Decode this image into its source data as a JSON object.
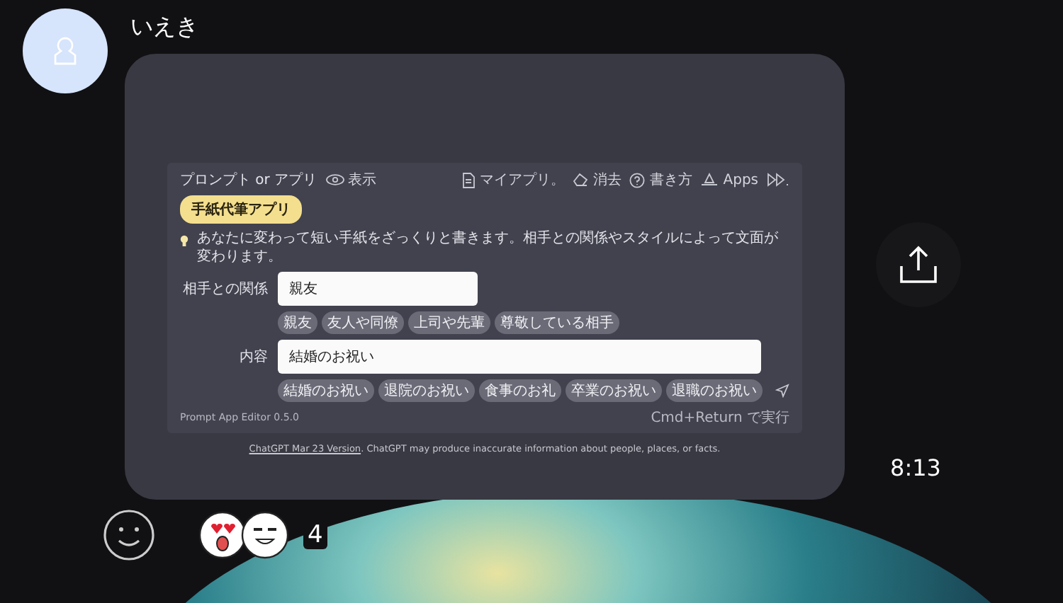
{
  "sender": {
    "name": "いえき"
  },
  "screenshot": {
    "toolbar": {
      "title": "プロンプト or アプリ",
      "view": "表示",
      "actions": [
        {
          "kind": "document",
          "label": "マイアプリ。"
        },
        {
          "kind": "eraser",
          "label": "消去"
        },
        {
          "kind": "help",
          "label": "書き方"
        },
        {
          "kind": "hat",
          "label": "Apps"
        },
        {
          "kind": "forward"
        }
      ]
    },
    "app_badge": "手紙代筆アプリ",
    "description": "あなたに変わって短い手紙をざっくりと書きます。相手との関係やスタイルによって文面が変わります。",
    "fields": [
      {
        "label": "相手との関係",
        "value": "親友",
        "suggestions": [
          "親友",
          "友人や同僚",
          "上司や先輩",
          "尊敬している相手"
        ]
      },
      {
        "label": "内容",
        "value": "結婚のお祝い",
        "suggestions": [
          "結婚のお祝い",
          "退院のお祝い",
          "食事のお礼",
          "卒業のお祝い",
          "退職のお祝い"
        ]
      }
    ],
    "version": "Prompt App Editor 0.5.0",
    "hint": "Cmd+Return で実行",
    "disclaimer_link": "ChatGPT Mar 23 Version",
    "disclaimer": ". ChatGPT may produce inaccurate information about people, places, or facts."
  },
  "time": "8:13",
  "reactions": {
    "count": "4"
  }
}
